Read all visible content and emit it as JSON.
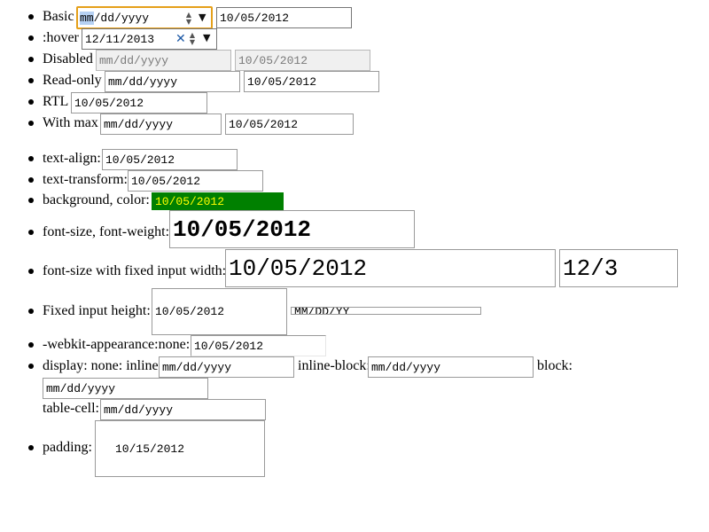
{
  "rows": {
    "basic": {
      "label": "Basic",
      "input1": "mm/dd/yyyy",
      "input1_seg": "mm",
      "input1_rest": "/dd/yyyy",
      "input2": "10/05/2012"
    },
    "hover": {
      "label": ":hover",
      "input1": "12/11/2013"
    },
    "disabled": {
      "label": "Disabled",
      "input1": "mm/dd/yyyy",
      "input2": "10/05/2012"
    },
    "readonly": {
      "label": "Read-only",
      "input1": "mm/dd/yyyy",
      "input2": "10/05/2012"
    },
    "rtl": {
      "label": "RTL",
      "input1": "10/05/2012"
    },
    "withmax": {
      "label": "With max",
      "input1": "mm/dd/yyyy",
      "input2": "10/05/2012"
    },
    "textalign": {
      "label": "text-align:",
      "input1": "10/05/2012"
    },
    "texttransform": {
      "label": "text-transform:",
      "input1": "10/05/2012"
    },
    "bgcolor": {
      "label": "background, color:",
      "input1": "10/05/2012"
    },
    "fontsize": {
      "label": "font-size, font-weight:",
      "input1": "10/05/2012"
    },
    "fontsizefixed": {
      "label": "font-size with fixed input width:",
      "input1": "10/05/2012",
      "input2": "12/3"
    },
    "fixedheight": {
      "label": "Fixed input height:",
      "input1": "10/05/2012",
      "input2": "MM/DD/YY"
    },
    "appearance": {
      "label": "-webkit-appearance:none:",
      "input1": "10/05/2012"
    },
    "display": {
      "label": "display: none: inline:",
      "input1": "mm/dd/yyyy",
      "inline_block_label": "inline-block:",
      "input2": "mm/dd/yyyy",
      "block_label": "block:",
      "input3": "mm/dd/yyyy",
      "table_cell_label": "table-cell:",
      "input4": "mm/dd/yyyy"
    },
    "padding": {
      "label": "padding:",
      "input1": "10/15/2012"
    }
  },
  "icons": {
    "spin": "spinner-arrows-icon",
    "caret": "dropdown-caret-icon",
    "clear": "clear-x-icon"
  },
  "colors": {
    "focus_border": "#e5a01a",
    "selected_segment": "#b6d1f3",
    "bg_input": "#008000",
    "bg_input_text": "#ffff00",
    "clear_icon": "#1c58a5"
  }
}
